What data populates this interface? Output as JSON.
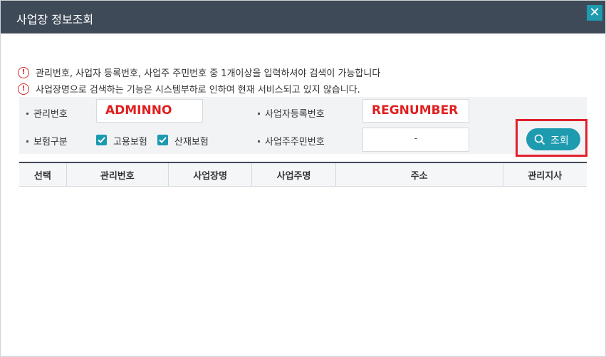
{
  "dialog": {
    "title": "사업장 정보조회",
    "close_glyph": "✕"
  },
  "notices": [
    "관리번호, 사업자 등록번호, 사업주 주민번호 중 1개이상을 입력하셔야 검색이 가능합니다",
    "사업장명으로 검색하는 기능은 시스템부하로 인하여 현재 서비스되고 있지 않습니다."
  ],
  "notice_icon_glyph": "!",
  "search": {
    "mgmt_no_label": "관리번호",
    "mgmt_no_value": "ADMINNO",
    "reg_no_label": "사업자등록번호",
    "reg_no_value": "REGNUMBER",
    "insurance_label": "보험구분",
    "employment_insurance_label": "고용보험",
    "employment_insurance_checked": true,
    "industrial_insurance_label": "산재보험",
    "industrial_insurance_checked": true,
    "owner_id_label": "사업주주민번호",
    "owner_id_value": "-",
    "search_button_label": "조회"
  },
  "table": {
    "columns": [
      "선택",
      "관리번호",
      "사업장명",
      "사업주명",
      "주소",
      "관리지사"
    ],
    "rows": []
  },
  "colors": {
    "title_bar": "#3e4a57",
    "accent": "#1f9bb0",
    "highlight": "#e0202a",
    "input_value": "#e02020"
  }
}
